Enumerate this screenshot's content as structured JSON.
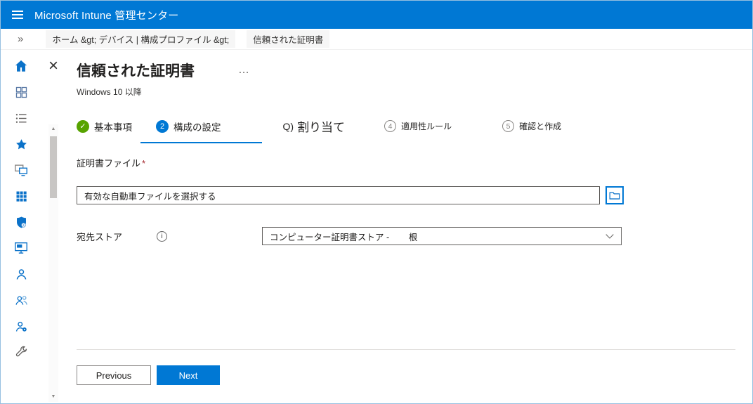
{
  "topbar": {
    "title": "Microsoft Intune 管理センター"
  },
  "breadcrumb": {
    "collapse_icon": "»",
    "path": "ホーム &gt; デバイス | 構成プロファイル &gt;",
    "current": "信頼された証明書"
  },
  "page": {
    "close_icon": "×",
    "title": "信頼された証明書",
    "more_icon": "…",
    "subtitle": "Windows 10 以降"
  },
  "steps": {
    "items": [
      {
        "marker": "✓",
        "label": "基本事項",
        "state": "completed"
      },
      {
        "marker": "2",
        "label": "構成の設定",
        "state": "active"
      },
      {
        "marker": "Q)",
        "label": "割り当て",
        "state": "plain"
      },
      {
        "marker": "4",
        "label": "適用性ルール",
        "state": "upcoming"
      },
      {
        "marker": "5",
        "label": "確認と作成",
        "state": "upcoming"
      }
    ]
  },
  "form": {
    "certificate_file_label": "証明書ファイル",
    "required_marker": "*",
    "certificate_file_value": "有効な自動車ファイルを選択する",
    "destination_store_label": "宛先ストア",
    "info_icon": "i",
    "destination_store_value": "コンピューター証明書ストア -        根"
  },
  "scrollbar": {
    "up_icon": "▲",
    "down_icon": "▼"
  },
  "footer": {
    "previous_label": "Previous",
    "next_label": "Next"
  },
  "sidebar": {
    "icons": [
      "home",
      "dashboard",
      "all-services",
      "favorites",
      "devices",
      "apps",
      "endpoint-security",
      "reports",
      "users",
      "groups",
      "tenant-administration",
      "troubleshooting"
    ]
  },
  "colors": {
    "accent": "#0078d4",
    "success_green": "#57a300"
  }
}
